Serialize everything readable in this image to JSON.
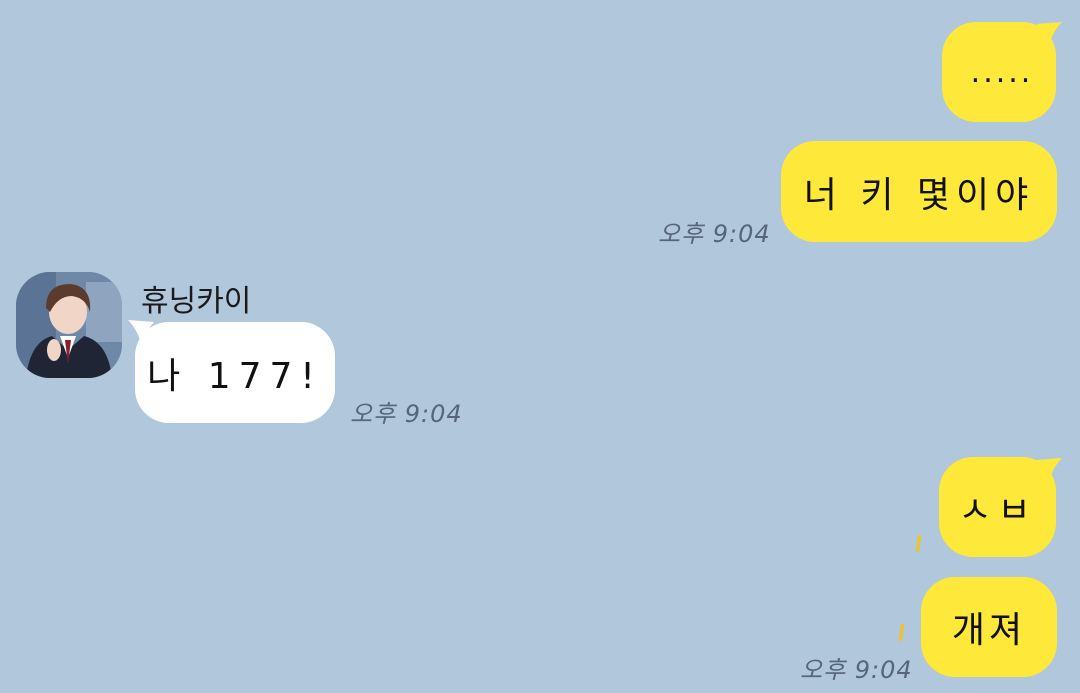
{
  "chat": {
    "background_color": "#b1c7dc",
    "my_bubble_color": "#fee83a",
    "their_bubble_color": "#ffffff",
    "partner": {
      "name": "휴닝카이",
      "avatar_icon": "profile-photo-icon"
    },
    "messages": [
      {
        "sender": "me",
        "text": "....."
      },
      {
        "sender": "me",
        "text": "너 키 몇이야",
        "time": "오후 9:04"
      },
      {
        "sender": "partner",
        "text": "나 177!",
        "time": "오후 9:04"
      },
      {
        "sender": "me",
        "text": "ㅅㅂ"
      },
      {
        "sender": "me",
        "text": "개져",
        "time": "오후 9:04"
      }
    ]
  }
}
